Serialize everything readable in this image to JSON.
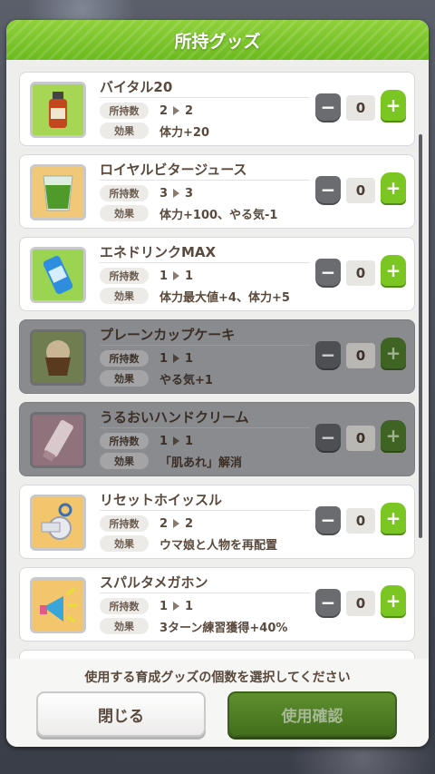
{
  "dialog": {
    "title": "所持グッズ"
  },
  "labels": {
    "owned": "所持数",
    "effect": "効果"
  },
  "items": [
    {
      "name": "バイタル20",
      "owned_before": "2",
      "owned_after": "2",
      "effect": "体力+20",
      "count": "0",
      "icon": "vital-drink-icon",
      "disabled": false
    },
    {
      "name": "ロイヤルビタージュース",
      "owned_before": "3",
      "owned_after": "3",
      "effect": "体力+100、やる気-1",
      "count": "0",
      "icon": "green-juice-icon",
      "disabled": false
    },
    {
      "name": "エネドリンクMAX",
      "owned_before": "1",
      "owned_after": "1",
      "effect": "体力最大値+4、体力+5",
      "count": "0",
      "icon": "energy-can-icon",
      "disabled": false
    },
    {
      "name": "プレーンカップケーキ",
      "owned_before": "1",
      "owned_after": "1",
      "effect": "やる気+1",
      "count": "0",
      "icon": "cupcake-icon",
      "disabled": true
    },
    {
      "name": "うるおいハンドクリーム",
      "owned_before": "1",
      "owned_after": "1",
      "effect": "「肌あれ」解消",
      "count": "0",
      "icon": "hand-cream-icon",
      "disabled": true
    },
    {
      "name": "リセットホイッスル",
      "owned_before": "2",
      "owned_after": "2",
      "effect": "ウマ娘と人物を再配置",
      "count": "0",
      "icon": "whistle-icon",
      "disabled": false
    },
    {
      "name": "スパルタメガホン",
      "owned_before": "1",
      "owned_after": "1",
      "effect": "3ターン練習獲得+40%",
      "count": "0",
      "icon": "megaphone-icon",
      "disabled": false
    }
  ],
  "footer": {
    "message": "使用する育成グッズの個数を選択してください",
    "close_label": "閉じる",
    "confirm_label": "使用確認"
  },
  "colors": {
    "accent_green": "#7cc623",
    "header_green": "#6cba1f",
    "text_brown": "#5a4a3e"
  }
}
